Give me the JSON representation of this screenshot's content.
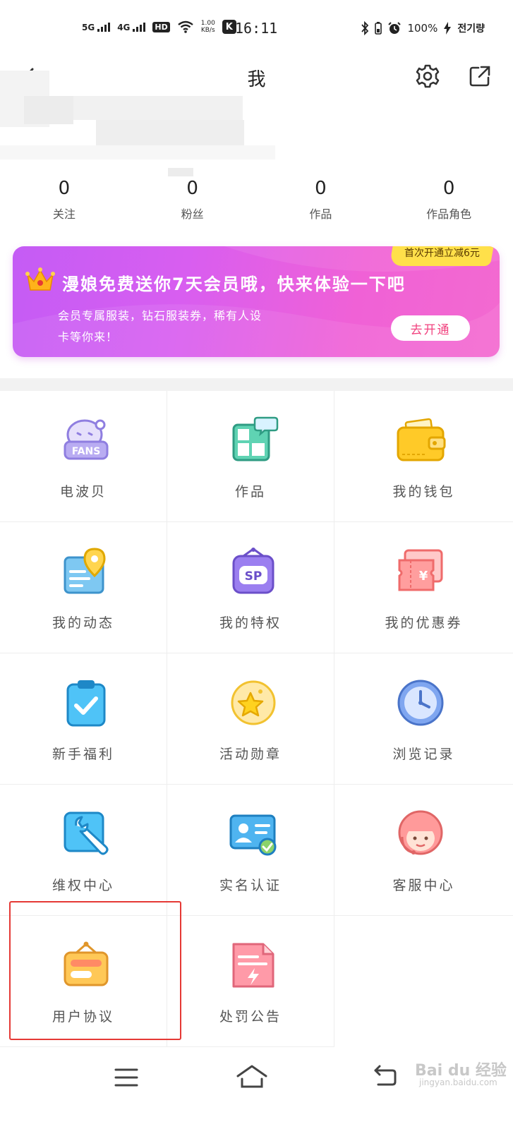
{
  "status_bar": {
    "signal1": "5G",
    "signal2": "4G",
    "hd": "HD",
    "speed_top": "1.00",
    "speed_bottom": "KB/s",
    "k_badge": "K",
    "time": "16:11",
    "battery": "100%",
    "charging": "전기량"
  },
  "header": {
    "title": "我"
  },
  "stats": [
    {
      "value": "0",
      "label": "关注"
    },
    {
      "value": "0",
      "label": "粉丝"
    },
    {
      "value": "0",
      "label": "作品"
    },
    {
      "value": "0",
      "label": "作品角色"
    }
  ],
  "banner": {
    "badge": "首次开通立减6元",
    "title": "漫娘免费送你7天会员哦，快来体验一下吧",
    "desc": "会员专属服装，钻石服装券，稀有人设卡等你来！",
    "button": "去开通",
    "gradient_start": "#c45cf5",
    "gradient_end": "#f36ad0"
  },
  "grid": [
    {
      "label": "电波贝",
      "icon": "fans-icon"
    },
    {
      "label": "作品",
      "icon": "works-icon"
    },
    {
      "label": "我的钱包",
      "icon": "wallet-icon"
    },
    {
      "label": "我的动态",
      "icon": "location-card-icon"
    },
    {
      "label": "我的特权",
      "icon": "sp-privilege-icon"
    },
    {
      "label": "我的优惠券",
      "icon": "coupon-icon"
    },
    {
      "label": "新手福利",
      "icon": "clipboard-check-icon"
    },
    {
      "label": "活动勋章",
      "icon": "star-medal-icon"
    },
    {
      "label": "浏览记录",
      "icon": "clock-icon"
    },
    {
      "label": "维权中心",
      "icon": "wrench-icon"
    },
    {
      "label": "实名认证",
      "icon": "id-card-icon"
    },
    {
      "label": "客服中心",
      "icon": "support-agent-icon"
    },
    {
      "label": "用户协议",
      "icon": "signboard-icon"
    },
    {
      "label": "处罚公告",
      "icon": "notice-document-icon"
    }
  ],
  "watermark": {
    "text": "Bai du 经验",
    "sub": "jingyan.baidu.com"
  }
}
